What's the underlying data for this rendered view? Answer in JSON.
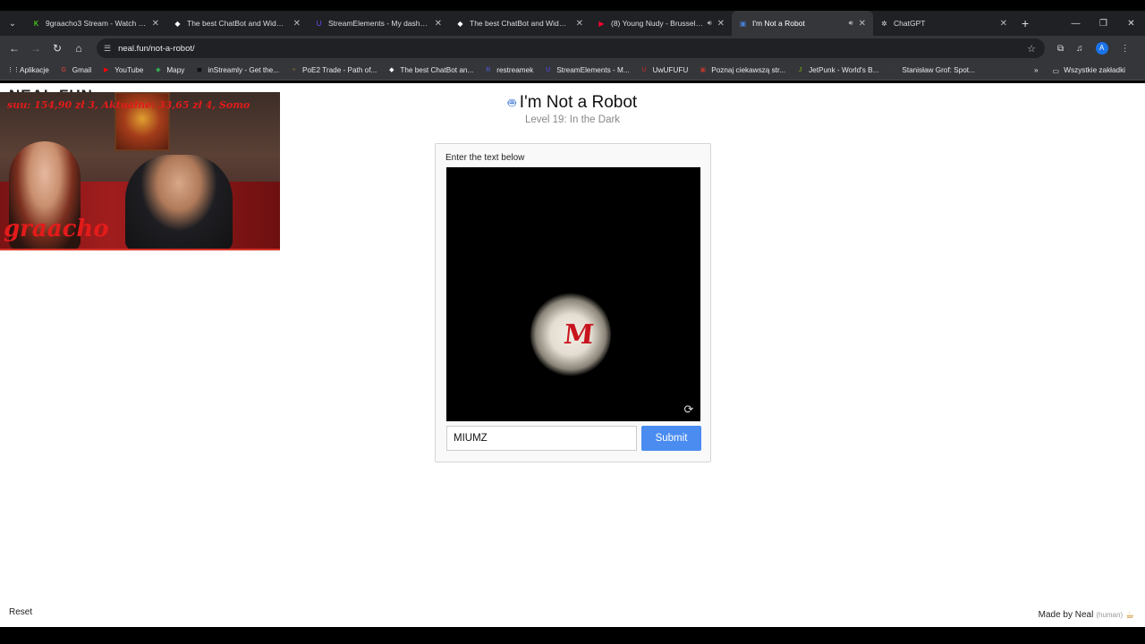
{
  "browser": {
    "tabs": [
      {
        "title": "9graacho3 Stream - Watch Live",
        "icon_color": "#53fc18",
        "icon": "K"
      },
      {
        "title": "The best ChatBot and Widgets",
        "icon_color": "#ffffff",
        "icon": "◆"
      },
      {
        "title": "StreamElements - My dashboard",
        "icon_color": "#5b4dff",
        "icon": "U"
      },
      {
        "title": "The best ChatBot and Widgets",
        "icon_color": "#ffffff",
        "icon": "◆"
      },
      {
        "title": "(8) Young Nudy - Brussel Sp",
        "icon_color": "#ff0033",
        "icon": "▶"
      },
      {
        "title": "I'm Not a Robot",
        "icon_color": "#4a7fd6",
        "icon": "▣"
      },
      {
        "title": "ChatGPT",
        "icon_color": "#dddddd",
        "icon": "✲"
      }
    ],
    "url": "neal.fun/not-a-robot/",
    "profile_initial": "A",
    "bookmarks": [
      {
        "label": "Aplikacje",
        "icon": "⋮⋮",
        "color": "#e8eaed"
      },
      {
        "label": "Gmail",
        "icon": "G",
        "color": "#ea4335"
      },
      {
        "label": "YouTube",
        "icon": "▶",
        "color": "#ff0000"
      },
      {
        "label": "Mapy",
        "icon": "◆",
        "color": "#34a853"
      },
      {
        "label": "inStreamly - Get the...",
        "icon": "◼",
        "color": "#111111"
      },
      {
        "label": "PoE2 Trade - Path of...",
        "icon": "✦",
        "color": "#6b5a3a"
      },
      {
        "label": "The best ChatBot an...",
        "icon": "◆",
        "color": "#ffffff"
      },
      {
        "label": "restreamek",
        "icon": "R",
        "color": "#4f5ee8"
      },
      {
        "label": "StreamElements - M...",
        "icon": "U",
        "color": "#5b4dff"
      },
      {
        "label": "UwUFUFU",
        "icon": "U",
        "color": "#d62b2b"
      },
      {
        "label": "Poznaj ciekawszą str...",
        "icon": "▣",
        "color": "#c0392b"
      },
      {
        "label": "JetPunk - World's B...",
        "icon": "J",
        "color": "#7fb800"
      },
      {
        "label": "Stanisław Grof: Spot...",
        "icon": "◦",
        "color": "#444444"
      }
    ],
    "bookmarks_folder": "Wszystkie zakładki"
  },
  "page": {
    "site_logo": "NEAL.FUN",
    "title": "I'm Not a Robot",
    "subtitle": "Level 19: In the Dark",
    "prompt": "Enter the text below",
    "captcha_visible_glyph": "M",
    "answer_value": "MIUMZ",
    "submit_label": "Submit",
    "reset_label": "Reset",
    "made_by": "Made by Neal",
    "made_by_note": "(human)"
  },
  "stream_overlay": {
    "top_text": "suu: 154,90 zł 3, Aktualne: 33,65 zł 4, Somo",
    "name": "graacho"
  }
}
